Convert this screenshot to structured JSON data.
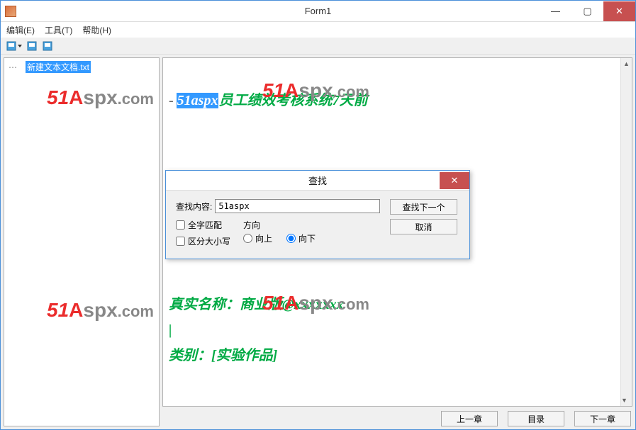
{
  "window": {
    "title": "Form1",
    "min": "—",
    "max": "▢",
    "close": "✕"
  },
  "menu": {
    "edit": "编辑(E)",
    "tools": "工具(T)",
    "help": "帮助(H)"
  },
  "tree": {
    "item": "新建文本文档.txt"
  },
  "doc": {
    "line1_highlight": "51aspx",
    "line1_rest": "员工绩效考核系统7天前",
    "line2a": "商业",
    "line2b": "真实名称：商业版@xxxxxxx",
    "caret": "|",
    "line3": "类别：[实验作品]"
  },
  "watermark": "51Aspx.com",
  "footer": {
    "prev": "上一章",
    "toc": "目录",
    "next": "下一章"
  },
  "find": {
    "title": "查找",
    "label": "查找内容:",
    "value": "51aspx",
    "whole_word": "全字匹配",
    "match_case": "区分大小写",
    "direction_label": "方向",
    "up": "向上",
    "down": "向下",
    "find_next": "查找下一个",
    "cancel": "取消",
    "close": "✕"
  }
}
